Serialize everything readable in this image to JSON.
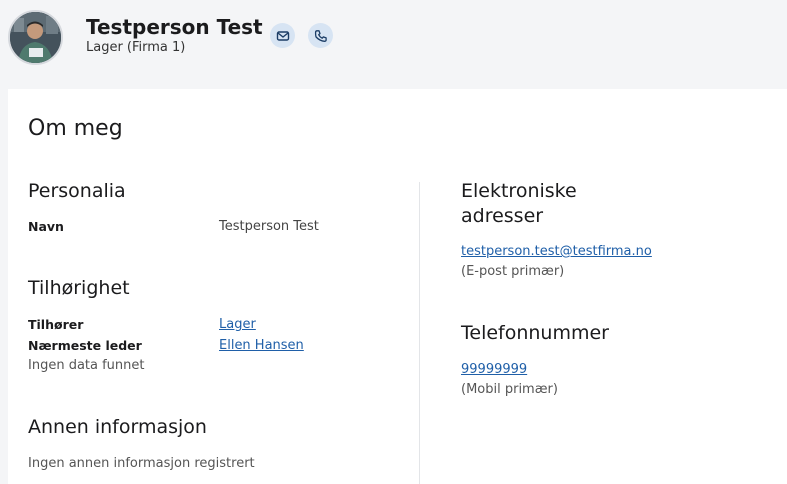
{
  "profile": {
    "name": "Testperson Test",
    "subtitle": "Lager (Firma 1)",
    "mail_icon": "mail-icon",
    "phone_icon": "phone-icon"
  },
  "about": {
    "title": "Om meg",
    "personalia": {
      "title": "Personalia",
      "name_label": "Navn",
      "name_value": "Testperson Test"
    },
    "affiliation": {
      "title": "Tilhørighet",
      "belongs_label": "Tilhører",
      "belongs_value": "Lager",
      "manager_label": "Nærmeste leder",
      "manager_value": "Ellen Hansen",
      "no_data": "Ingen data funnet"
    },
    "other": {
      "title": "Annen informasjon",
      "text": "Ingen annen informasjon registrert"
    },
    "electronic": {
      "title_line1": "Elektroniske",
      "title_line2": "adresser",
      "email": "testperson.test@testfirma.no",
      "email_type": "(E-post primær)"
    },
    "phone": {
      "title": "Telefonnummer",
      "number": "99999999",
      "number_type": "(Mobil primær)"
    }
  },
  "colors": {
    "background": "#f4f5f7",
    "card": "#ffffff",
    "link": "#1f5fa8",
    "icon_button": "#d7e4f3"
  }
}
